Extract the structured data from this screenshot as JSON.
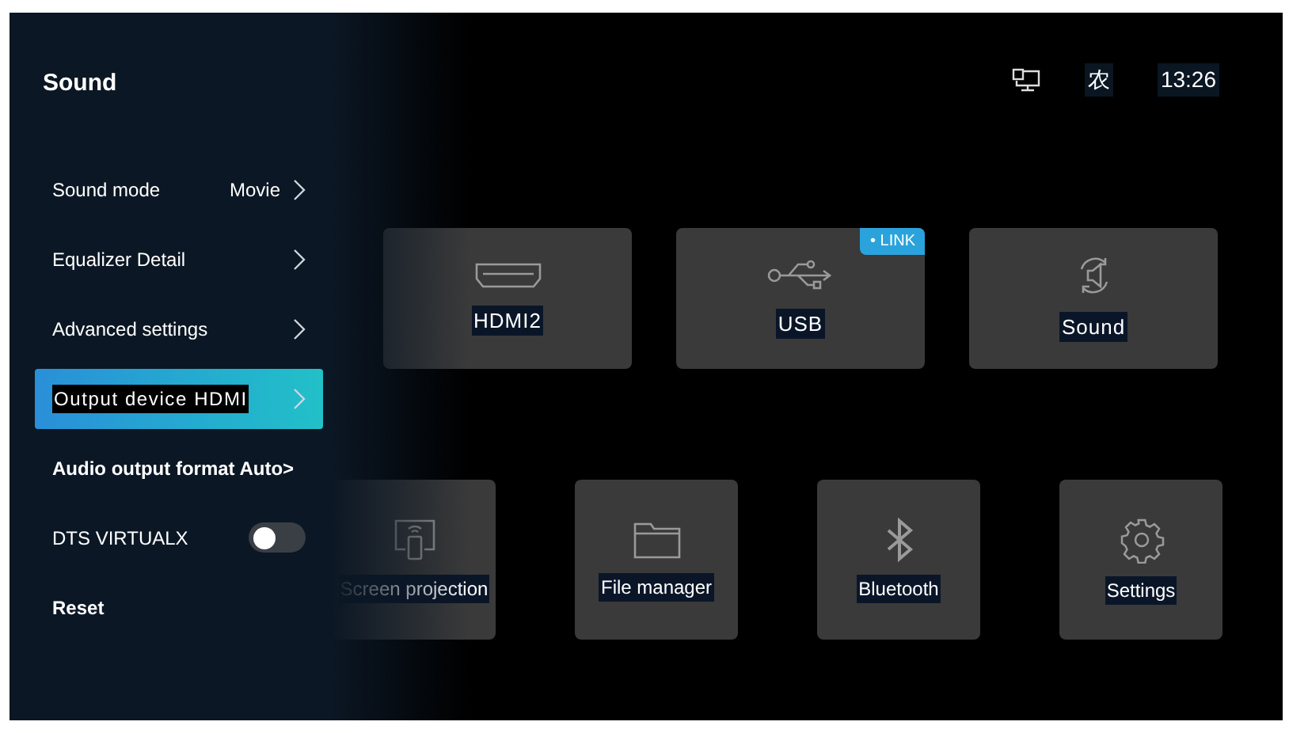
{
  "panel": {
    "title": "Sound",
    "items": [
      {
        "kind": "link",
        "label": "Sound mode",
        "value": "Movie",
        "selected": false
      },
      {
        "kind": "link",
        "label": "Equalizer Detail",
        "selected": false
      },
      {
        "kind": "link",
        "label": "Advanced settings",
        "selected": false
      },
      {
        "kind": "link",
        "label": "Output device HDMI",
        "selected": true
      },
      {
        "kind": "bold",
        "label": "Audio output format Auto>",
        "selected": false
      },
      {
        "kind": "toggle",
        "label": "DTS VIRTUALX",
        "on": false,
        "selected": false
      },
      {
        "kind": "bold",
        "label": "Reset",
        "selected": false
      }
    ]
  },
  "status_bar": {
    "input_label": "农",
    "time": "13:26"
  },
  "top_cards": [
    {
      "kind": "hdmi",
      "label": "HDMI2"
    },
    {
      "kind": "usb",
      "label": "USB",
      "badge": "• LINK"
    },
    {
      "kind": "sound",
      "label": "Sound"
    }
  ],
  "bottom_cards": [
    {
      "kind": "cast",
      "label": "Screen projection"
    },
    {
      "kind": "folder",
      "label": "File manager"
    },
    {
      "kind": "bluetooth",
      "label": "Bluetooth"
    },
    {
      "kind": "gear",
      "label": "Settings"
    }
  ]
}
